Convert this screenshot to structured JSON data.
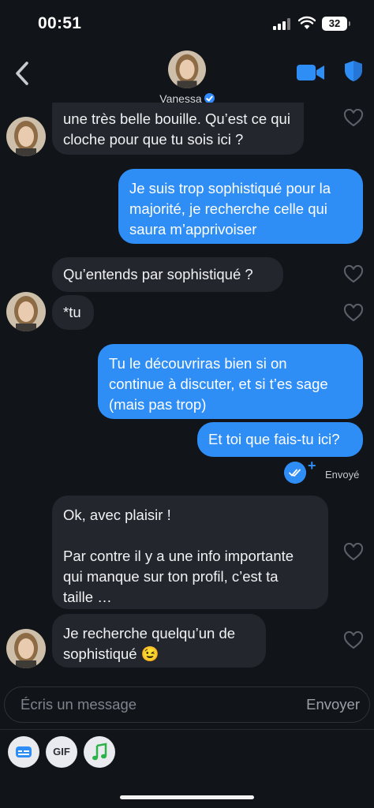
{
  "status_bar": {
    "time": "00:51",
    "battery": "32"
  },
  "header": {
    "contact_name": "Vanessa"
  },
  "messages": [
    {
      "id": "m1",
      "direction": "in",
      "text": "une très belle bouille. Qu’est ce qui\ncloche pour que tu sois ici ?"
    },
    {
      "id": "m2",
      "direction": "out",
      "text": "Je suis trop sophistiqué pour la\nmajorité, je recherche celle qui\nsaura m’apprivoiser"
    },
    {
      "id": "m3",
      "direction": "in",
      "text": "Qu’entends par sophistiqué ?"
    },
    {
      "id": "m4",
      "direction": "in",
      "text": "*tu"
    },
    {
      "id": "m5",
      "direction": "out",
      "text": "Tu le découvriras bien si on\ncontinue à discuter, et si t’es sage\n(mais pas trop)"
    },
    {
      "id": "m6",
      "direction": "out",
      "text": "Et toi que fais-tu ici?"
    },
    {
      "id": "m7",
      "direction": "in",
      "text": "Ok, avec plaisir !\n\nPar contre il y a une info importante\nqui manque sur ton profil, c’est ta\ntaille …"
    },
    {
      "id": "m8",
      "direction": "in",
      "text": "Je recherche quelqu’un de\nsophistiqué 😉"
    }
  ],
  "delivery_status": "Envoyé",
  "composer": {
    "placeholder": "Écris un message",
    "send_label": "Envoyer"
  },
  "toolbar": {
    "gif_label": "GIF"
  },
  "colors": {
    "background": "#111418",
    "incoming_bubble": "#23262d",
    "outgoing_bubble": "#2f8ef6",
    "accent": "#2f8ef6"
  }
}
